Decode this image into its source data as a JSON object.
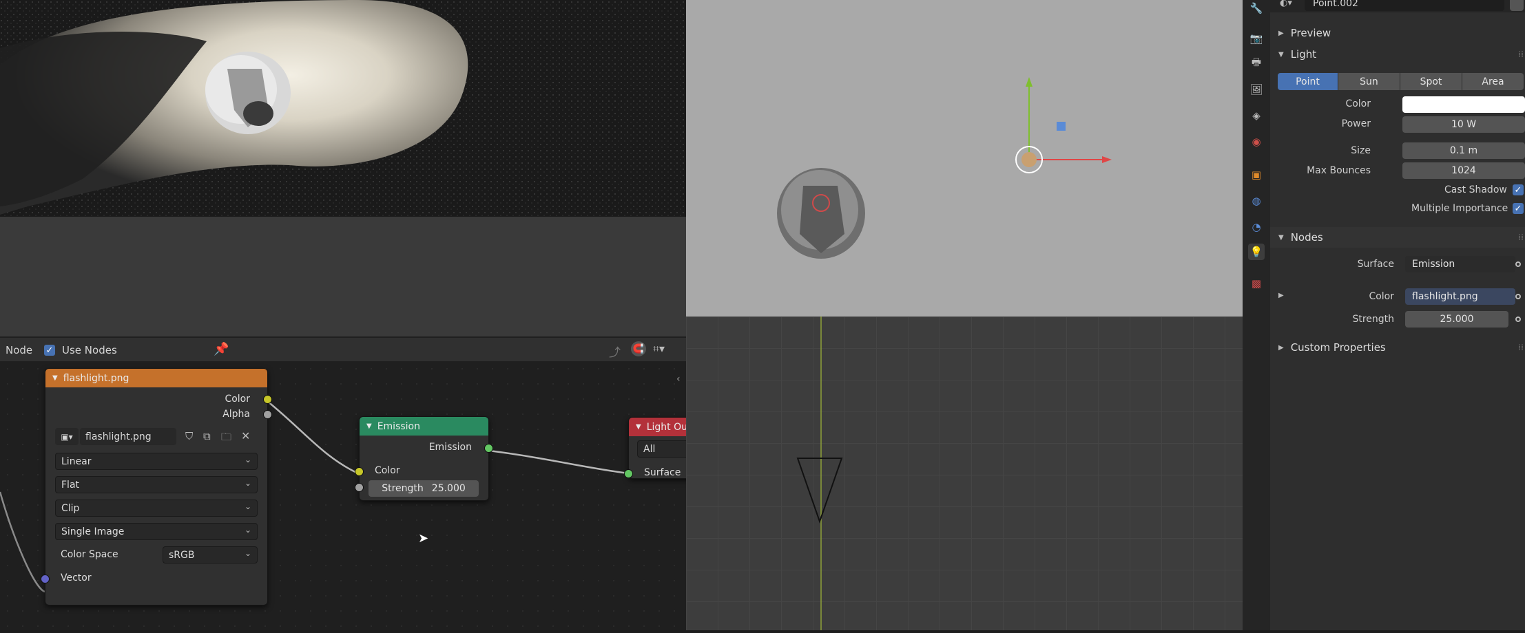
{
  "node_editor": {
    "header": {
      "menu_node": "Node",
      "use_nodes_label": "Use Nodes",
      "use_nodes_checked": true
    },
    "image_node": {
      "title": "flashlight.png",
      "outputs": [
        "Color",
        "Alpha"
      ],
      "image_name": "flashlight.png",
      "interpolation": "Linear",
      "projection": "Flat",
      "extension": "Clip",
      "source": "Single Image",
      "color_space_label": "Color Space",
      "color_space_value": "sRGB",
      "input_vector": "Vector"
    },
    "emission_node": {
      "title": "Emission",
      "output": "Emission",
      "input_color": "Color",
      "strength_label": "Strength",
      "strength_value": "25.000"
    },
    "output_node": {
      "title": "Light Ou",
      "target": "All",
      "input_surface": "Surface"
    }
  },
  "properties": {
    "object_name": "Point.002",
    "panels": {
      "preview": "Preview",
      "light": "Light",
      "nodes": "Nodes",
      "custom": "Custom Properties"
    },
    "light_types": [
      "Point",
      "Sun",
      "Spot",
      "Area"
    ],
    "active_light_type": "Point",
    "light_fields": {
      "color_label": "Color",
      "power_label": "Power",
      "power_value": "10 W",
      "size_label": "Size",
      "size_value": "0.1 m",
      "max_bounces_label": "Max Bounces",
      "max_bounces_value": "1024",
      "cast_shadow_label": "Cast Shadow",
      "multiple_importance_label": "Multiple Importance"
    },
    "nodes_fields": {
      "surface_label": "Surface",
      "surface_value": "Emission",
      "color_label": "Color",
      "color_value": "flashlight.png",
      "strength_label": "Strength",
      "strength_value": "25.000"
    }
  },
  "colors": {
    "accent": "#4772b3",
    "image_header": "#c5712b",
    "emission_header": "#2a8a60",
    "output_header": "#b3313a"
  }
}
